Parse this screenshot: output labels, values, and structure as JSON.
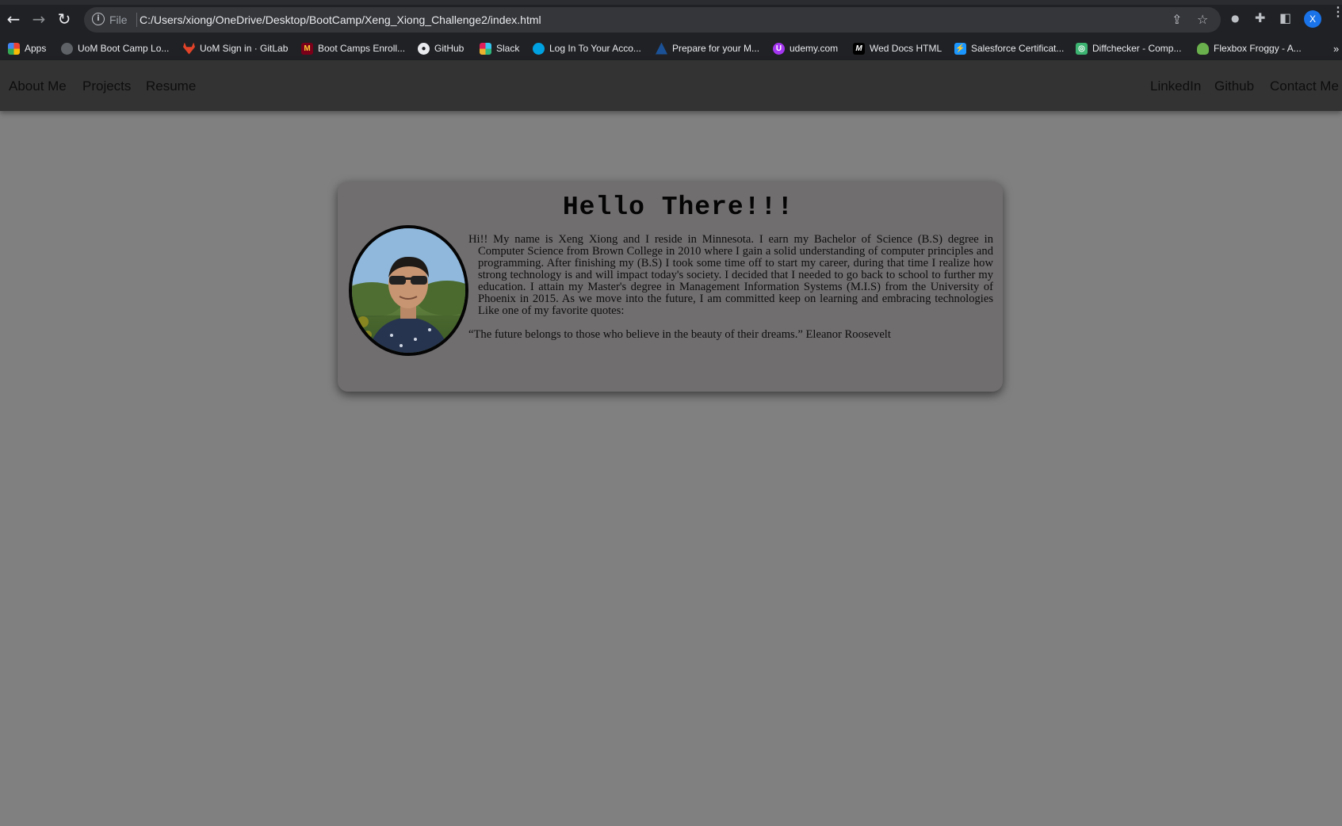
{
  "browser": {
    "omnibox": {
      "scheme_label": "File",
      "url": "C:/Users/xiong/OneDrive/Desktop/BootCamp/Xeng_Xiong_Challenge2/index.html"
    },
    "profile_initial": "X",
    "bookmarks": [
      {
        "label": "Apps",
        "icon": "apps-grid-icon",
        "color": "#ea4335"
      },
      {
        "label": "UoM Boot Camp Lo...",
        "icon": "bootcamp-icon",
        "color": "#5f6368"
      },
      {
        "label": "UoM Sign in · GitLab",
        "icon": "gitlab-icon",
        "color": "#e24329"
      },
      {
        "label": "Boot Camps Enroll...",
        "icon": "umn-icon",
        "color": "#7a0019"
      },
      {
        "label": "GitHub",
        "icon": "github-icon",
        "color": "#e8eaed"
      },
      {
        "label": "Slack",
        "icon": "slack-icon",
        "color": "#e01e5a"
      },
      {
        "label": "Log In To Your Acco...",
        "icon": "salesforce-icon",
        "color": "#00a1e0"
      },
      {
        "label": "Prepare for your M...",
        "icon": "trailhead-icon",
        "color": "#032d60"
      },
      {
        "label": "udemy.com",
        "icon": "udemy-icon",
        "color": "#a435f0"
      },
      {
        "label": "Wed Docs HTML",
        "icon": "mdn-icon",
        "color": "#000000"
      },
      {
        "label": "Salesforce Certificat...",
        "icon": "salesforce-cert-icon",
        "color": "#1b96ff"
      },
      {
        "label": "Diffchecker - Comp...",
        "icon": "diffchecker-icon",
        "color": "#3cb371"
      },
      {
        "label": "Flexbox Froggy - A...",
        "icon": "froggy-icon",
        "color": "#6ab04c"
      }
    ],
    "bookmarks_overflow": "»"
  },
  "nav": {
    "left": [
      "About Me",
      "Projects",
      "Resume"
    ],
    "right": [
      "LinkedIn",
      "Github",
      "Contact Me"
    ]
  },
  "card": {
    "title": "Hello There!!!",
    "bio": "Hi!! My name is Xeng Xiong and I reside in Minnesota. I earn my Bachelor of Science (B.S) degree in Computer Science from Brown College in 2010 where I gain a solid understanding of computer principles and programming. After finishing my (B.S) I took some time off to start my career, during that time I realize how strong technology is and will impact today's society. I decided that I needed to go back to school to further my education. I attain my Master's degree in Management Information Systems (M.I.S) from the University of Phoenix in 2015. As we move into the future, I am committed keep on learning and embracing technologies Like one of my favorite quotes:",
    "quote": "“The future belongs to those who believe in the beauty of their dreams.” Eleanor Roosevelt"
  },
  "colors": {
    "page_bg": "#808080",
    "nav_bg": "#333333",
    "card_bg": "#716e6f"
  }
}
